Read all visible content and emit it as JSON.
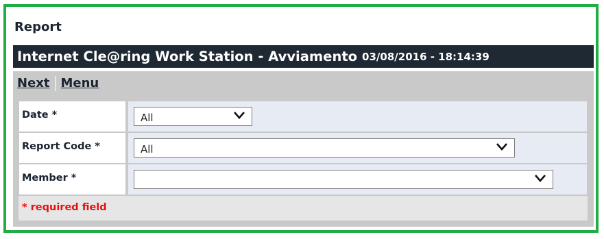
{
  "report_heading": "Report",
  "title_bar": {
    "title": "Internet Cle@ring Work Station - Avviamento",
    "timestamp": "03/08/2016 - 18:14:39"
  },
  "nav": {
    "next_label": "Next",
    "menu_label": "Menu"
  },
  "form": {
    "date": {
      "label": "Date *",
      "value": "All"
    },
    "report_code": {
      "label": "Report Code *",
      "value": "All"
    },
    "member": {
      "label": "Member *",
      "value": ""
    }
  },
  "required_note": "* required field",
  "colors": {
    "frame_border": "#21ad46",
    "title_bar_bg": "#1e2933",
    "field_bg": "#e6ebf4",
    "required_text": "#e81010"
  },
  "icons": {
    "dropdown": "chevron-down-icon"
  }
}
